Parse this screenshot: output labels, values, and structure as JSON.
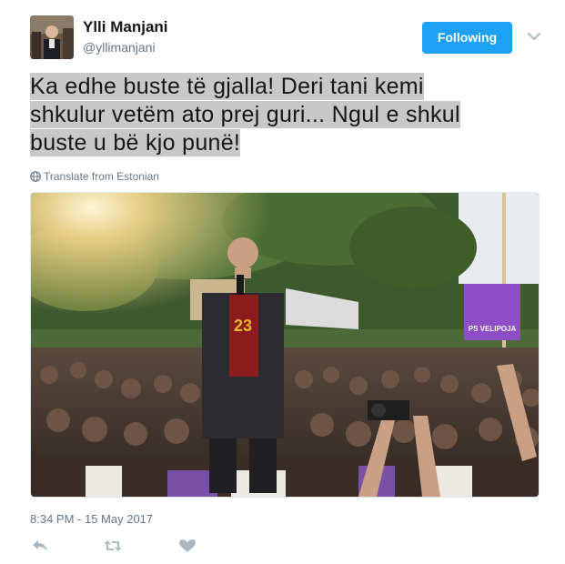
{
  "author": {
    "display_name": "Ylli Manjani",
    "username": "@yllimanjani"
  },
  "follow_button": {
    "label": "Following"
  },
  "tweet": {
    "lines": [
      "Ka edhe buste të gjalla! Deri tani kemi",
      "shkulur vetëm ato prej guri... Ngul e shkul",
      "buste u bë kjo punë!"
    ],
    "translate_label": "Translate from Estonian",
    "timestamp": "8:34 PM - 15 May 2017"
  },
  "media": {
    "sign_text_1": "PS VELIPOJA",
    "shirt_number": "23"
  },
  "icons": {
    "caret": "chevron-down-icon",
    "translate": "globe-icon",
    "reply": "reply-icon",
    "retweet": "retweet-icon",
    "like": "heart-icon"
  },
  "colors": {
    "accent": "#1da1f2",
    "highlight": "#c8c8c8",
    "muted": "#657786",
    "action_icon": "#aab8c2"
  }
}
